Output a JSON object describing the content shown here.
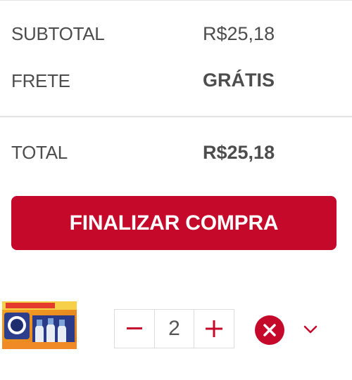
{
  "summary": {
    "subtotal_label": "SUBTOTAL",
    "subtotal_value": "R$25,18",
    "shipping_label": "FRETE",
    "shipping_value": "GRÁTIS",
    "total_label": "TOTAL",
    "total_value": "R$25,18"
  },
  "checkout": {
    "button_label": "FINALIZAR COMPRA"
  },
  "cart_item": {
    "thumbnail_icon": "product-box-icon",
    "quantity": "2",
    "decrement_icon": "minus-icon",
    "increment_icon": "plus-icon",
    "remove_icon": "close-circle-icon",
    "expand_icon": "chevron-down-icon"
  },
  "colors": {
    "accent": "#c4092a",
    "text": "#4d4d4d",
    "divider": "#e3e3e3"
  }
}
